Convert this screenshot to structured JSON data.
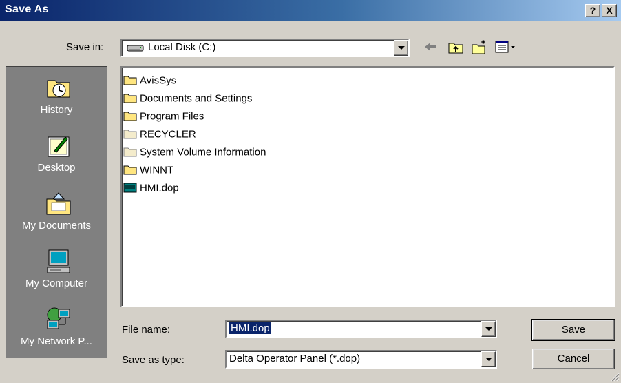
{
  "window": {
    "title": "Save As",
    "help_button": "?",
    "close_button": "X"
  },
  "save_in": {
    "label": "Save in:",
    "value": "Local Disk (C:)",
    "drive_icon": "hard-disk-icon"
  },
  "toolbar": {
    "back_icon": "back-arrow-icon",
    "up_icon": "up-folder-icon",
    "new_folder_icon": "new-folder-icon",
    "views_icon": "views-menu-icon"
  },
  "places": [
    {
      "label": "History",
      "icon": "history-icon"
    },
    {
      "label": "Desktop",
      "icon": "desktop-icon"
    },
    {
      "label": "My Documents",
      "icon": "my-documents-icon"
    },
    {
      "label": "My Computer",
      "icon": "my-computer-icon"
    },
    {
      "label": "My Network P...",
      "icon": "network-places-icon"
    }
  ],
  "files": [
    {
      "name": "AvisSys",
      "type": "folder"
    },
    {
      "name": "Documents and Settings",
      "type": "folder"
    },
    {
      "name": "Program Files",
      "type": "folder"
    },
    {
      "name": "RECYCLER",
      "type": "folder-hidden"
    },
    {
      "name": "System Volume Information",
      "type": "folder-hidden"
    },
    {
      "name": "WINNT",
      "type": "folder"
    },
    {
      "name": "HMI.dop",
      "type": "dop-file"
    }
  ],
  "file_name": {
    "label": "File name:",
    "value": "HMI.dop"
  },
  "save_as_type": {
    "label": "Save as type:",
    "value": "Delta Operator Panel (*.dop)"
  },
  "buttons": {
    "save": "Save",
    "cancel": "Cancel"
  },
  "colors": {
    "title_bar_start": "#0a246a",
    "title_bar_end": "#a6caf0",
    "dialog_face": "#d4d0c8",
    "places_bar": "#808080",
    "selection": "#0a246a"
  }
}
